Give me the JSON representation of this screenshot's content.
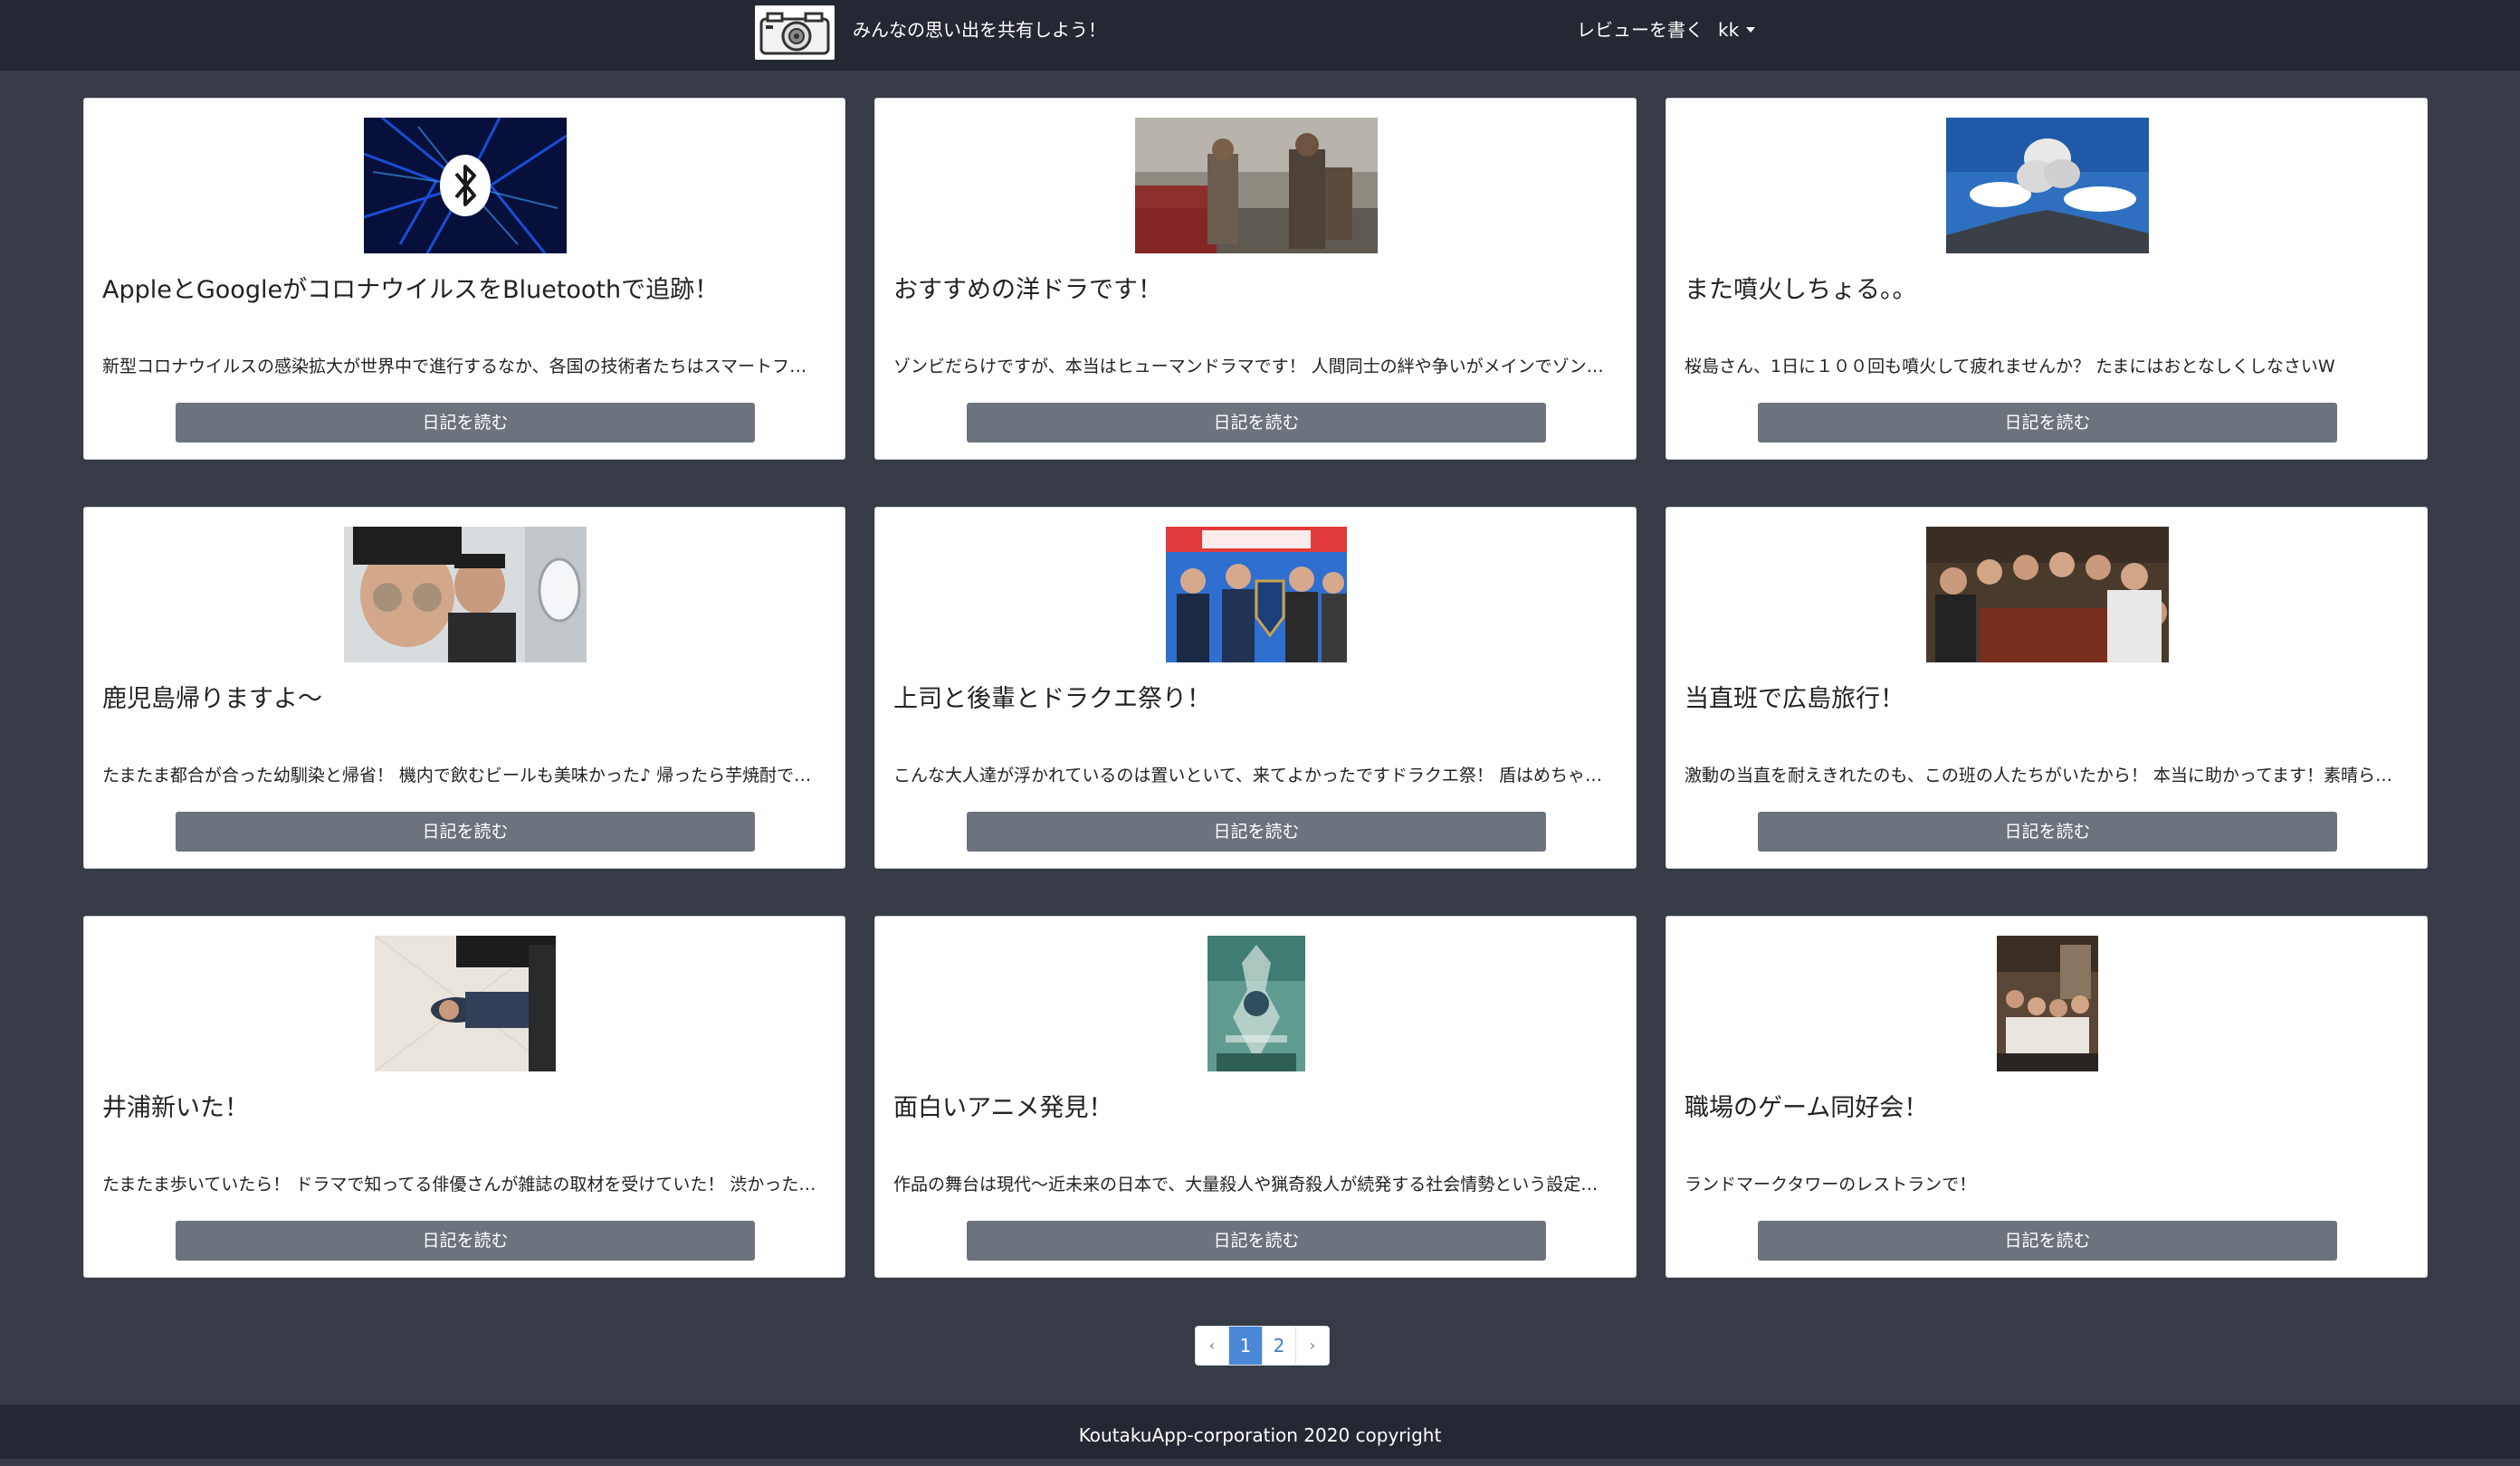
{
  "header": {
    "title": "みんなの思い出を共有しよう！",
    "write_review_label": "レビューを書く",
    "user_label": "kk",
    "logo_icon": "camera-icon"
  },
  "cards": [
    {
      "title": "AppleとGoogleがコロナウイルスをBluetoothで追跡！",
      "text": "新型コロナウイルスの感染拡大が世界中で進行するなか、各国の技術者たちはスマートフォンを活用した追跡技術の開発を進めています",
      "button": "日記を読む"
    },
    {
      "title": "おすすめの洋ドラです！",
      "text": "ゾンビだらけですが、本当はヒューマンドラマです！ 人間同士の絆や争いがメインでゾンビはおまけです",
      "button": "日記を読む"
    },
    {
      "title": "また噴火しちょる。。",
      "text": "桜島さん、1日に１００回も噴火して疲れませんか？ たまにはおとなしくしなさいW",
      "button": "日記を読む"
    },
    {
      "title": "鹿児島帰りますよ〜",
      "text": "たまたま都合が合った幼馴染と帰省！ 機内で飲むビールも美味かった♪ 帰ったら芋焼酎で乾杯しよう",
      "button": "日記を読む"
    },
    {
      "title": "上司と後輩とドラクエ祭り！",
      "text": "こんな大人達が浮かれているのは置いといて、来てよかったですドラクエ祭！ 盾はめちゃくちゃ重かったです",
      "button": "日記を読む"
    },
    {
      "title": "当直班で広島旅行！",
      "text": "激動の当直を耐えきれたのも、この班の人たちがいたから！ 本当に助かってます！素晴らしい仲間に感謝",
      "button": "日記を読む"
    },
    {
      "title": "井浦新いた！",
      "text": "たまたま歩いていたら！ ドラマで知ってる俳優さんが雑誌の取材を受けていた！ 渋かったです",
      "button": "日記を読む"
    },
    {
      "title": "面白いアニメ発見！",
      "text": "作品の舞台は現代〜近未来の日本で、大量殺人や猟奇殺人が続発する社会情勢という設定のアニメです",
      "button": "日記を読む"
    },
    {
      "title": "職場のゲーム同好会！",
      "text": "ランドマークタワーのレストランで！",
      "button": "日記を読む"
    }
  ],
  "pagination": {
    "prev": "‹",
    "pages": [
      "1",
      "2"
    ],
    "current": "1",
    "next": "›"
  },
  "footer": {
    "text": "KoutakuApp-corporation 2020 copyright"
  },
  "colors": {
    "page_bg": "#363b46",
    "header_bg": "#242832",
    "button_bg": "#6c737c",
    "pager_active": "#4a88d6"
  }
}
